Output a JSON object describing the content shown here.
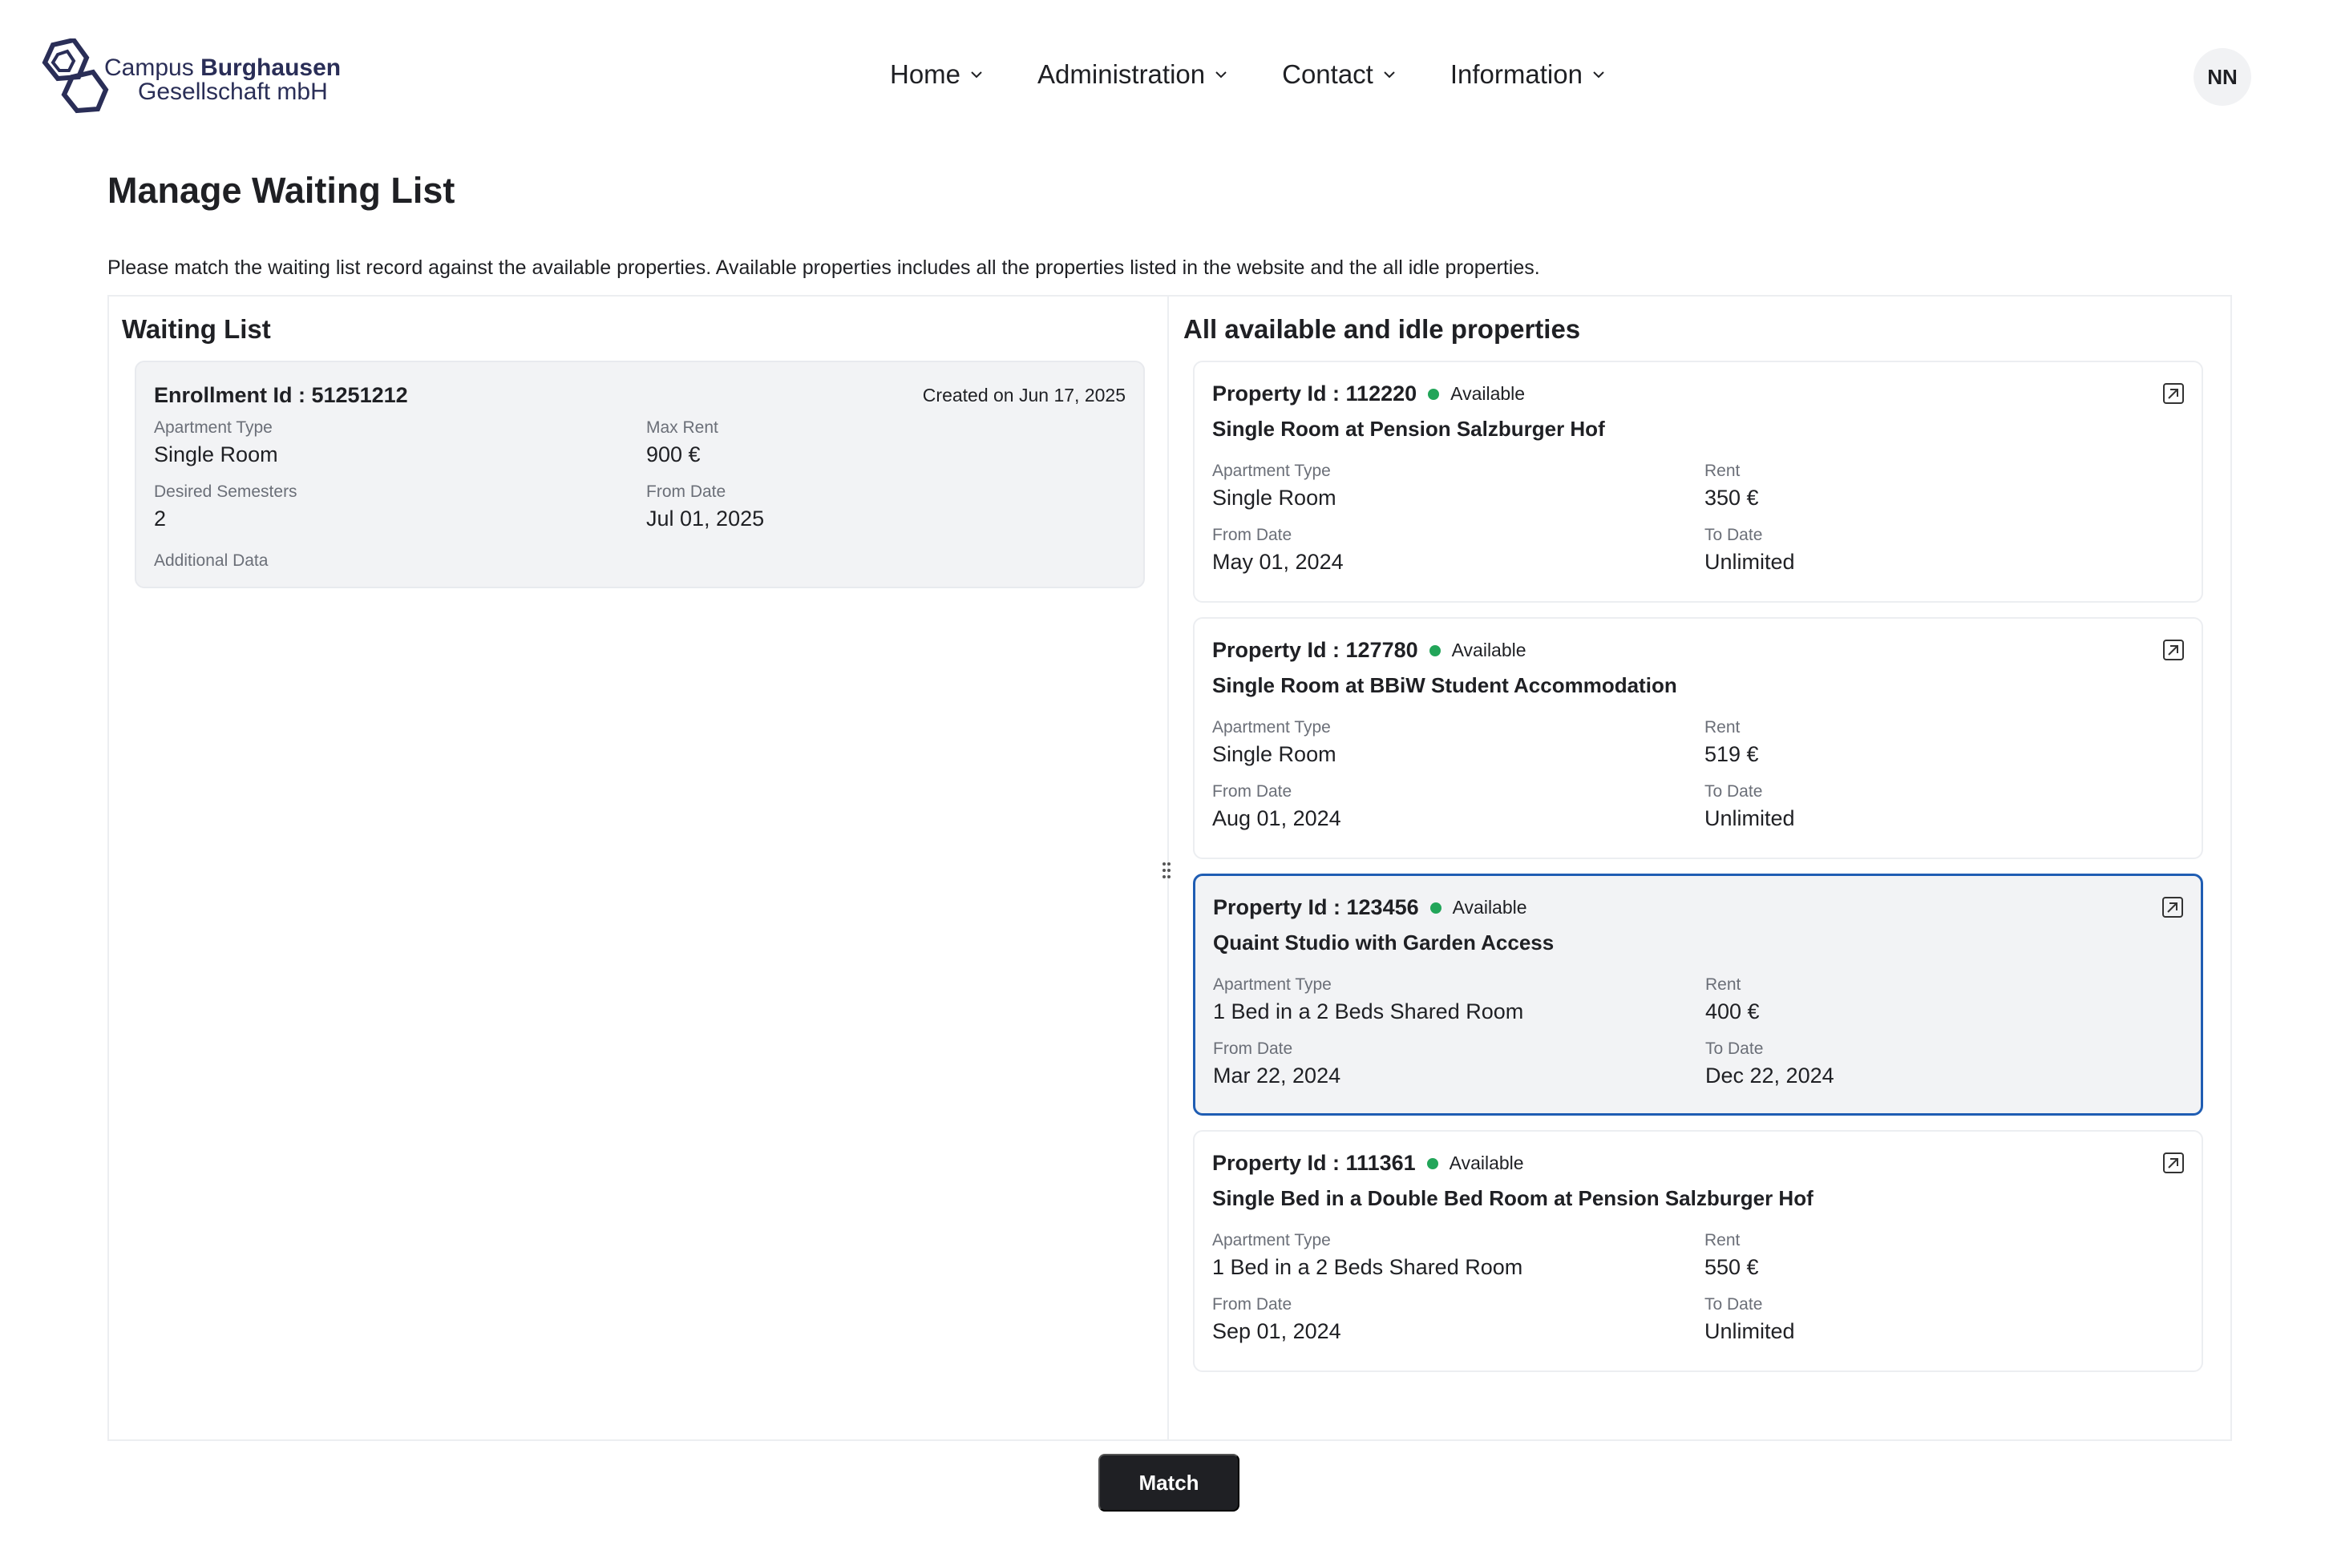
{
  "logo": {
    "line1_regular": "Campus",
    "line1_bold": "Burghausen",
    "line2": "Gesellschaft mbH"
  },
  "nav": [
    {
      "label": "Home"
    },
    {
      "label": "Administration"
    },
    {
      "label": "Contact"
    },
    {
      "label": "Information"
    }
  ],
  "user": {
    "initials": "NN"
  },
  "page": {
    "title": "Manage Waiting List",
    "description": "Please match the waiting list record against the available properties. Available properties includes all the properties listed in the website and the all idle properties."
  },
  "waiting_list": {
    "title": "Waiting List",
    "enrollment": {
      "enrollment_label": "Enrollment Id : 51251212",
      "created": "Created on Jun 17, 2025",
      "apartment_type_label": "Apartment Type",
      "apartment_type": "Single Room",
      "max_rent_label": "Max Rent",
      "max_rent": "900 €",
      "desired_semesters_label": "Desired Semesters",
      "desired_semesters": "2",
      "from_date_label": "From Date",
      "from_date": "Jul 01, 2025",
      "additional_data_label": "Additional Data"
    }
  },
  "properties": {
    "title": "All available and idle properties",
    "labels": {
      "apartment_type": "Apartment Type",
      "rent": "Rent",
      "from_date": "From Date",
      "to_date": "To Date"
    },
    "items": [
      {
        "id": "Property Id : 112220",
        "status": "Available",
        "name": "Single Room at Pension Salzburger Hof",
        "apartment_type": "Single Room",
        "rent": "350 €",
        "from_date": "May 01, 2024",
        "to_date": "Unlimited",
        "selected": false
      },
      {
        "id": "Property Id : 127780",
        "status": "Available",
        "name": "Single Room at BBiW Student Accommodation",
        "apartment_type": "Single Room",
        "rent": "519 €",
        "from_date": "Aug 01, 2024",
        "to_date": "Unlimited",
        "selected": false
      },
      {
        "id": "Property Id : 123456",
        "status": "Available",
        "name": "Quaint Studio with Garden Access",
        "apartment_type": "1 Bed in a 2 Beds Shared Room",
        "rent": "400 €",
        "from_date": "Mar 22, 2024",
        "to_date": "Dec 22, 2024",
        "selected": true
      },
      {
        "id": "Property Id : 111361",
        "status": "Available",
        "name": "Single Bed in a Double Bed Room at Pension Salzburger Hof",
        "apartment_type": "1 Bed in a 2 Beds Shared Room",
        "rent": "550 €",
        "from_date": "Sep 01, 2024",
        "to_date": "Unlimited",
        "selected": false
      }
    ]
  },
  "actions": {
    "match_label": "Match"
  },
  "colors": {
    "selected_border": "#1f5db3",
    "available_dot": "#22a559",
    "primary_button": "#1f2024"
  }
}
